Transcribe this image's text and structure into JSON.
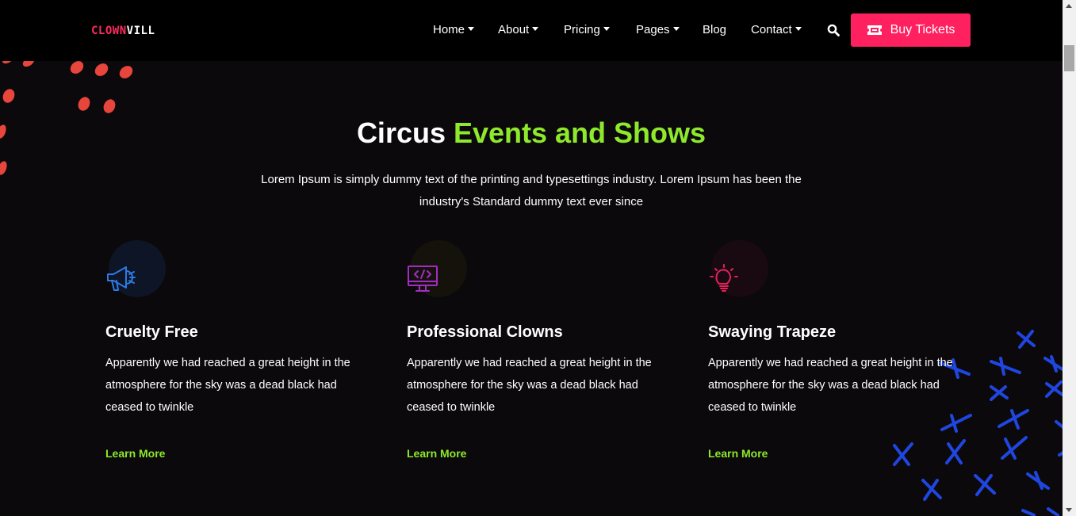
{
  "header": {
    "logo_part1": "CLOWN",
    "logo_part2": "VILL",
    "nav": [
      {
        "label": "Home",
        "dropdown": true
      },
      {
        "label": "About",
        "dropdown": true
      },
      {
        "label": "Pricing",
        "dropdown": true
      },
      {
        "label": "Pages",
        "dropdown": true
      },
      {
        "label": "Blog",
        "dropdown": false
      },
      {
        "label": "Contact",
        "dropdown": true
      }
    ],
    "search_icon": "search-icon",
    "cta_label": "Buy Tickets",
    "cta_icon": "ticket-icon"
  },
  "section": {
    "title_part1": "Circus ",
    "title_part2": "Events and Shows",
    "description": "Lorem Ipsum is simply dummy text of the printing and typesettings industry. Lorem Ipsum has been the industry's Standard dummy text ever since",
    "cards": [
      {
        "icon": "megaphone-icon",
        "title": "Cruelty Free",
        "text": "Apparently we had reached a great height in the atmosphere for the sky was a dead black had ceased to twinkle",
        "link": "Learn More"
      },
      {
        "icon": "monitor-code-icon",
        "title": "Professional Clowns",
        "text": "Apparently we had reached a great height in the atmosphere for the sky was a dead black had ceased to twinkle",
        "link": "Learn More"
      },
      {
        "icon": "lightbulb-icon",
        "title": "Swaying Trapeze",
        "text": "Apparently we had reached a great height in the atmosphere for the sky was a dead black had ceased to twinkle",
        "link": "Learn More"
      }
    ]
  },
  "colors": {
    "accent_pink": "#ff2060",
    "accent_green": "#8ee82c",
    "background": "#0b090b",
    "header_bg": "#000000",
    "deco_dots": "#e8453c",
    "deco_x": "#1f46e0"
  }
}
